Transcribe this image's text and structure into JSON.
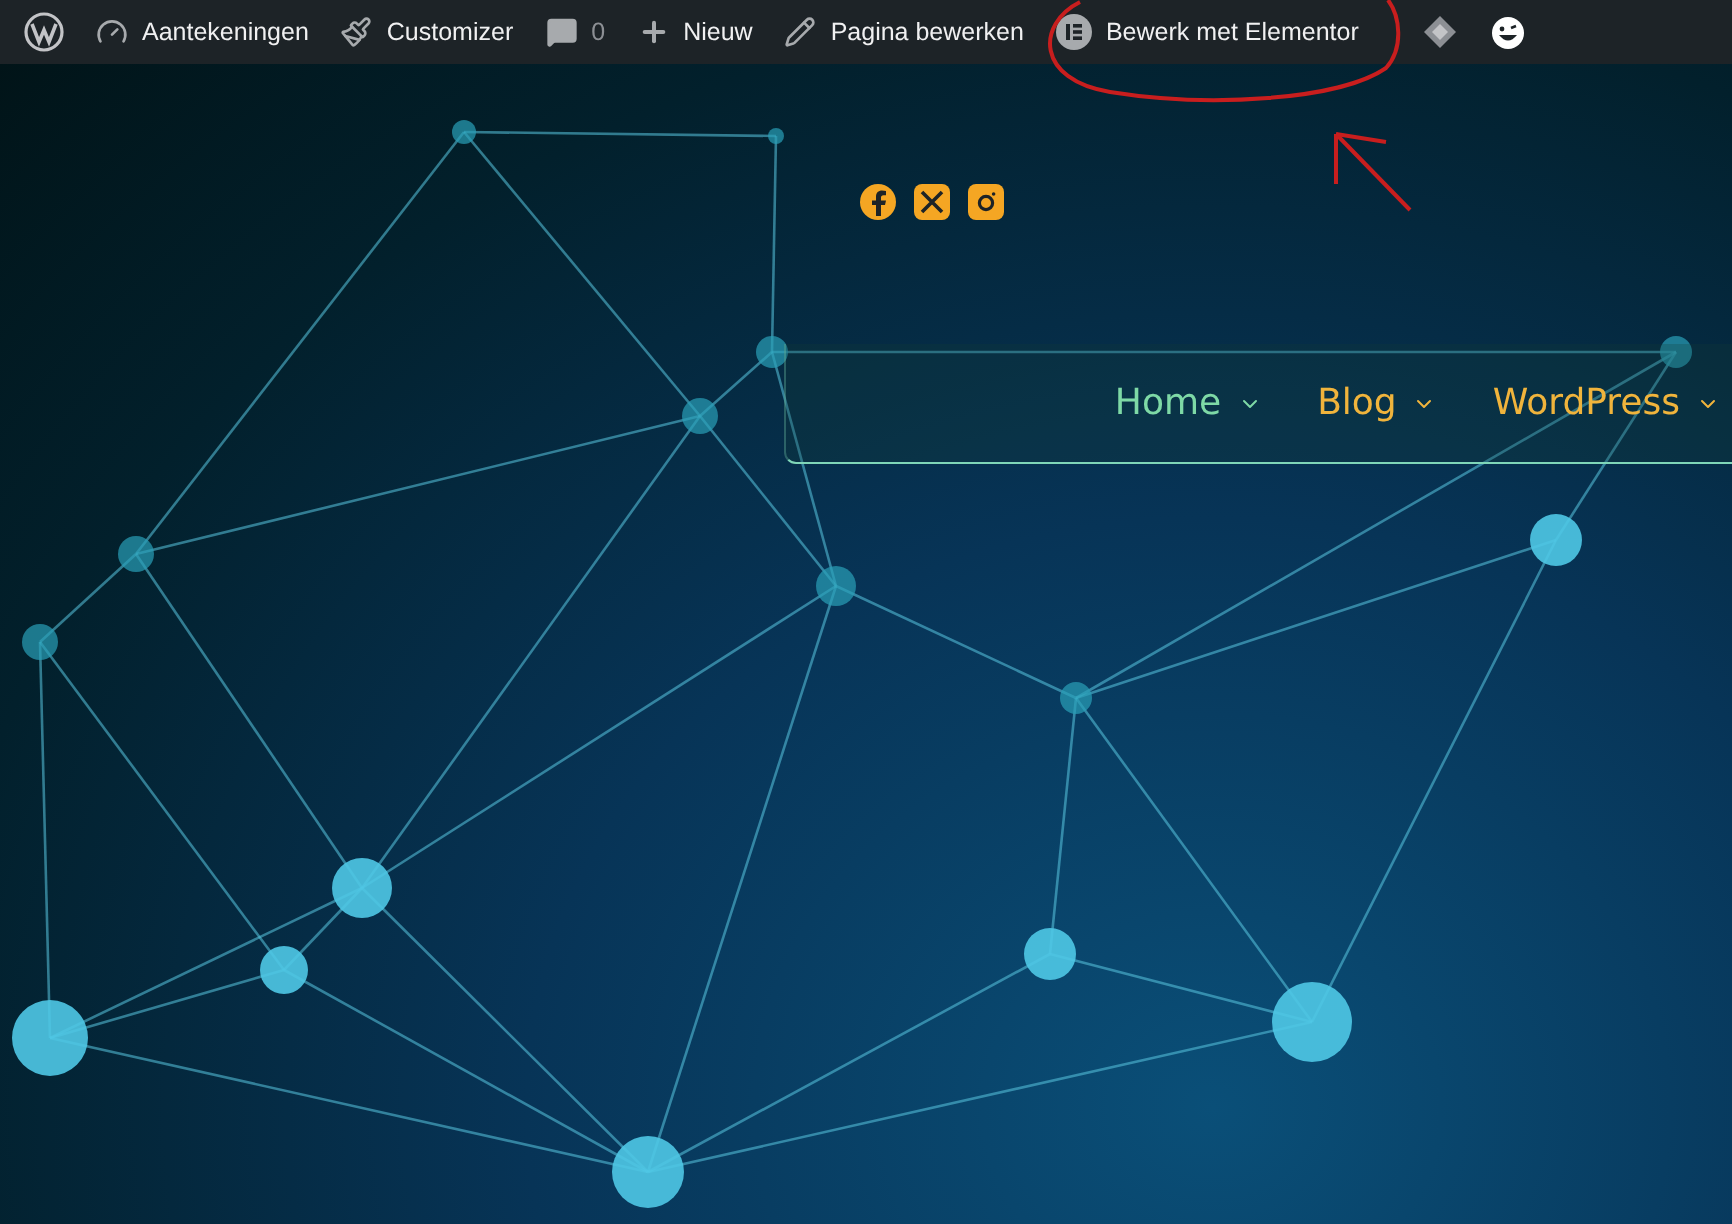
{
  "admin_bar": {
    "items": [
      {
        "kind": "logo"
      },
      {
        "kind": "dashboard",
        "label": "Aantekeningen"
      },
      {
        "kind": "customize",
        "label": "Customizer"
      },
      {
        "kind": "comments",
        "label": "0"
      },
      {
        "kind": "new",
        "label": "Nieuw"
      },
      {
        "kind": "edit",
        "label": "Pagina bewerken"
      },
      {
        "kind": "elementor",
        "label": "Bewerk met Elementor"
      },
      {
        "kind": "diamond"
      },
      {
        "kind": "avatar"
      }
    ]
  },
  "menu": {
    "items": [
      {
        "label": "Home",
        "selected": true
      },
      {
        "label": "Blog",
        "selected": false
      },
      {
        "label": "WordPress",
        "selected": false
      }
    ]
  }
}
